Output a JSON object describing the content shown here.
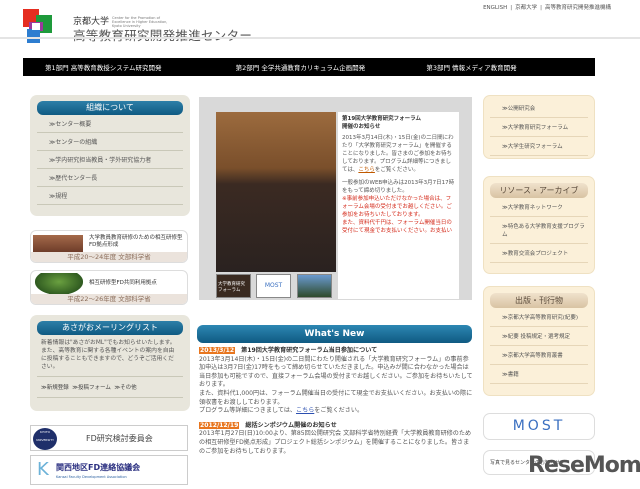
{
  "top_links": [
    "ENGLISH",
    "京都大学",
    "高等教育研究開発推進機構"
  ],
  "header": {
    "sub": "京都大学",
    "sub_en": "Center for the Promotion of Excellence in Higher Education, Kyoto University",
    "title": "高等教育研究開発推進センター"
  },
  "nav": [
    "第1部門 高等教育教授システム研究開発",
    "第2部門 全学共通教育カリキュラム企画開発",
    "第3部門 情報メディア教育開発"
  ],
  "left": {
    "org_title": "組織について",
    "org_items": [
      "≫センター概要",
      "≫センターの組織",
      "≫学内研究担当教員・学外研究協力者",
      "≫歴代センター長",
      "≫規程"
    ],
    "banner1": {
      "text": "大学教員教育研修のための相互研修型FD拠点形成",
      "year": "平成20～24年度 文部科学省"
    },
    "banner2": {
      "text": "相互研修型FD共同利用拠点",
      "year": "平成22～26年度 文部科学省"
    },
    "mail_title": "あさがおメーリングリスト",
    "mail_text": "新着情報は\"あさがおML\"でもお知らせいたします。また、高等教育に関する各種イベントの案内を自由に投稿することもできますので、どうぞご活用ください。",
    "mail_links": [
      "≫新規登録",
      "≫投稿フォーム",
      "≫その他"
    ],
    "fd_label": "FD研究検討委員会",
    "fd_seal": "KYOTO UNIVERSITY",
    "kansai_label": "関西地区FD連絡協議会",
    "kansai_en": "Kansai Faculty Development Association"
  },
  "feature": {
    "title1": "第19回大学教育研究フォーラム",
    "title2": "開催のお知らせ",
    "p1": "2013年3月14日(木)・15日(金)の二日間にわたり「大学教育研究フォーラム」を開催することになりました。皆さまのご参加をお待ちしております。プログラム詳細等につきましては、",
    "link": "こちら",
    "p1_end": "をご覧ください。",
    "p2": "一般参加のWEB申込みは2013年3月7日17時をもって締め切りました。",
    "red1": "※事前参加申込いただけなかった場合は、フォーラム会場の受付までお越しください。ご参加をお待ちいたしております。",
    "red2": "また、資料代千円は、フォーラム開催当日の受付にて現金でお支払いください。お支払いの際",
    "thumb1": "大学教育研究フォーラム",
    "thumb2": "MOST"
  },
  "whats_new": {
    "title": "What's New",
    "items": [
      {
        "date": "2013/3/12",
        "title": "第19回大学教育研究フォーラム当日参加について",
        "body": "2013年3月14日(木)・15日(金)の二日間にわたり開催される「大学教育研究フォーラム」の事前参加申込は3月7日(金)17時をもって締め切らせていただきました。申込みが間に合わなかった場合は当日参加も可能ですので、直接フォーラム会場の受付までお越しください。ご参加をお待ちいたしております。",
        "body2": "また、資料代1,000円は、フォーラム開催当日の受付にて現金でお支払いください。お支払いの際に領収書をお渡ししております。",
        "body3": "プログラム等詳細につきましては、",
        "link": "こちら",
        "body3_end": "をご覧ください。"
      },
      {
        "date": "2012/12/19",
        "title": "総括シンポジウム開催のお知らせ",
        "body": "2013年1月27日(日)10:00より、第85回公開研究会 文部科学省特別経費「大学教員教育研修のための相互研修型FD拠点形成」プロジェクト総括シンポジウム」を開催することになりました。皆さまのご参加をお待ちしております。"
      }
    ]
  },
  "right": {
    "box1": [
      "≫公開研究会",
      "≫大学教育研究フォーラム",
      "≫大学生研究フォーラム"
    ],
    "archive_title": "リソース・アーカイブ",
    "archive": [
      "≫大学教育ネットワーク",
      "≫特色ある大学教育支援プログラム",
      "≫教育交流会プロジェクト"
    ],
    "pub_title": "出版・刊行物",
    "pub": [
      "≫京都大学高等教育研究(紀要)",
      "≫紀要 投稿規定・選考規定",
      "≫京都大学高等教育叢書",
      "≫書籍"
    ],
    "most": "MOST",
    "photo": "写真で見るセンターのお知らせ"
  },
  "watermark": "ReseMom"
}
